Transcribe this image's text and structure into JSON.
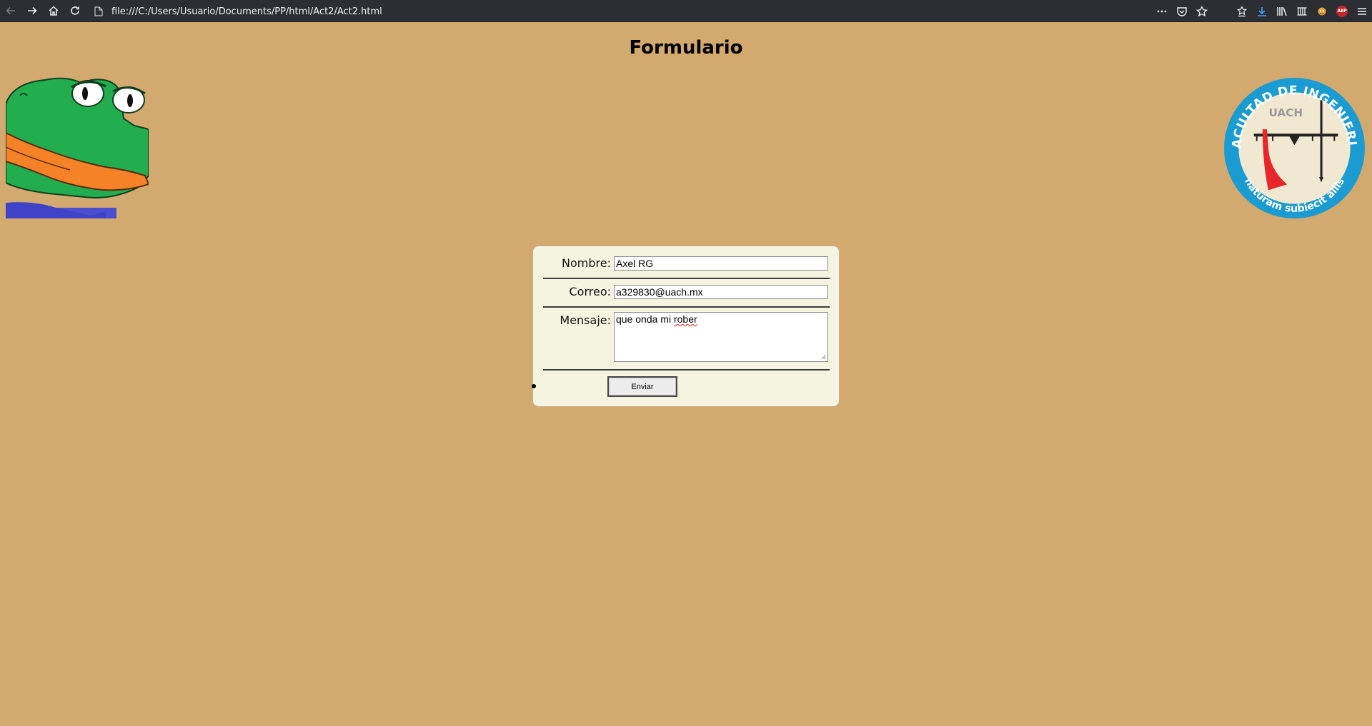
{
  "browser": {
    "url": "file:///C:/Users/Usuario/Documents/PP/html/Act2/Act2.html",
    "abp_badge": "ABP",
    "toolbar_icons": [
      "back-icon",
      "forward-icon",
      "home-icon",
      "reload-icon",
      "page-icon",
      "more-icon",
      "pocket-icon",
      "bookmark-star-icon",
      "reading-list-icon",
      "download-icon",
      "library-icon",
      "sidebar-icon",
      "extension-icon",
      "adblock-icon",
      "menu-icon"
    ]
  },
  "page": {
    "title": "Formulario",
    "background_color": "#d2a96f",
    "form_background": "#f5f4e0"
  },
  "logo": {
    "top_text": "FACULTAD DE INGENIERIA",
    "bottom_text": "naturam subiecit aliis",
    "center_text": "UACH",
    "ring_color": "#1a9bd1"
  },
  "form": {
    "nombre": {
      "label": "Nombre:",
      "value": "Axel RG"
    },
    "correo": {
      "label": "Correo:",
      "value": "a329830@uach.mx"
    },
    "mensaje": {
      "label": "Mensaje:",
      "value_plain": "que onda mi ",
      "value_misspelled": "rober"
    },
    "submit_label": "Enviar"
  }
}
